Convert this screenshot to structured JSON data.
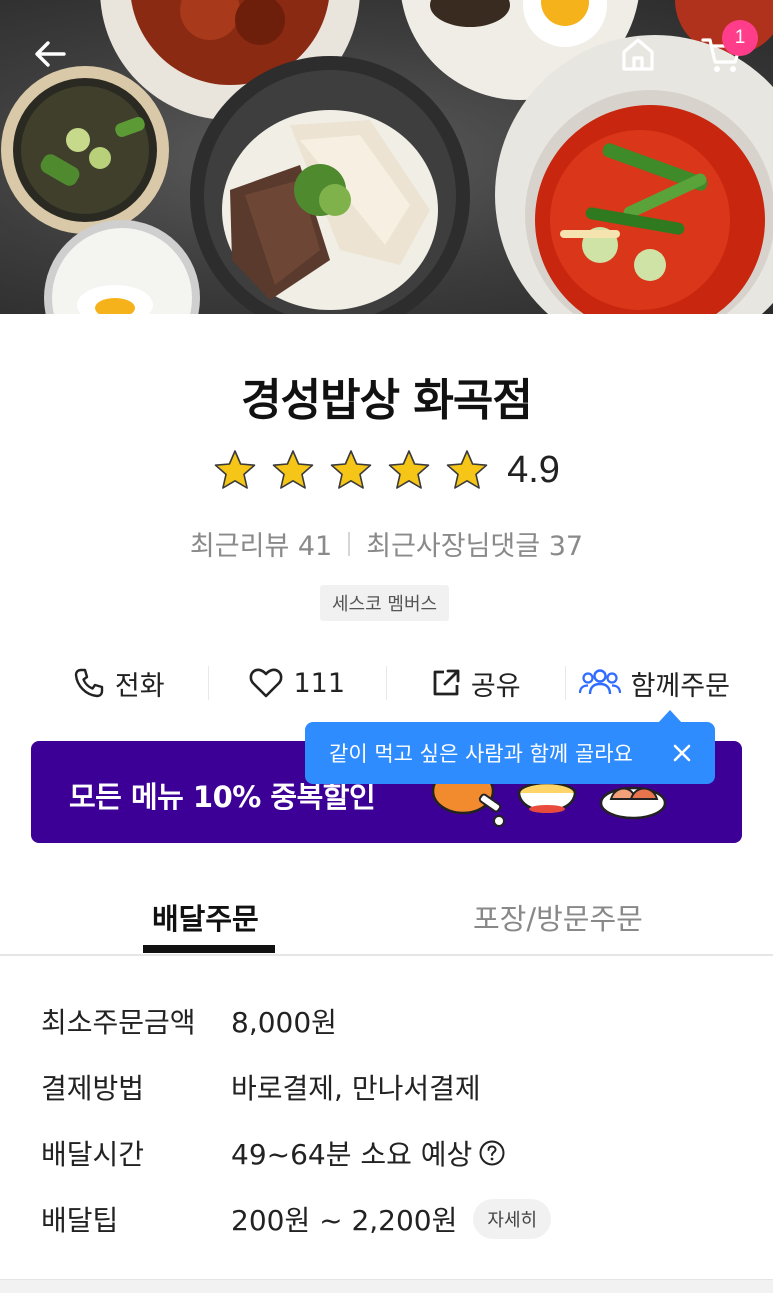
{
  "header": {
    "back_icon": "arrow-left-icon",
    "home_icon": "home-icon",
    "cart_icon": "cart-icon",
    "cart_count": "1"
  },
  "store": {
    "name": "경성밥상 화곡점",
    "rating": "4.9",
    "star_count": 5,
    "recent_reviews_label": "최근리뷰 41",
    "recent_owner_replies_label": "최근사장님댓글 37",
    "tag": "세스코 멤버스"
  },
  "actions": {
    "call_label": "전화",
    "like_count": "111",
    "share_label": "공유",
    "group_order_label": "함께주문"
  },
  "tooltip": {
    "text": "같이 먹고 싶은 사람과 함께 골라요"
  },
  "banner": {
    "text": "모든 메뉴 10% 중복할인",
    "color": "#3d0096"
  },
  "tabs": {
    "delivery_label": "배달주문",
    "pickup_label": "포장/방문주문"
  },
  "info": {
    "rows": [
      {
        "label": "최소주문금액",
        "value": "8,000원"
      },
      {
        "label": "결제방법",
        "value": "바로결제, 만나서결제"
      },
      {
        "label": "배달시간",
        "value": "49~64분 소요 예상"
      },
      {
        "label": "배달팁",
        "value": "200원 ~ 2,200원"
      }
    ],
    "detail_button_label": "자세히"
  },
  "colors": {
    "accent_blue": "#2f8cff",
    "badge_pink": "#ff3d8b",
    "star_yellow": "#f5c518"
  }
}
